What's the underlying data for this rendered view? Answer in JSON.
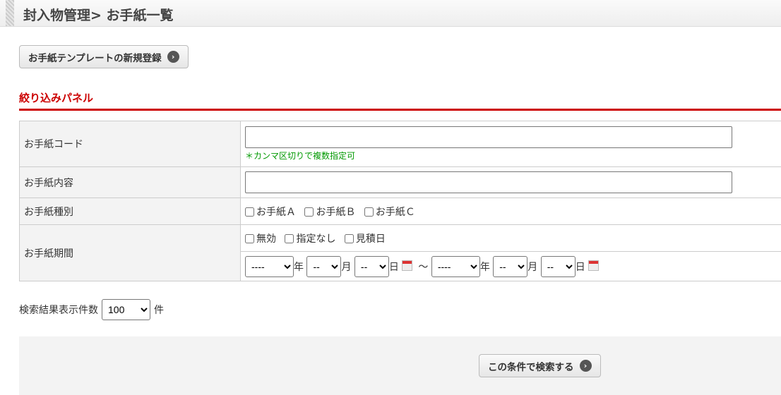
{
  "header": {
    "title": "封入物管理> お手紙一覧"
  },
  "new_button": "お手紙テンプレートの新規登録",
  "panel_title": "絞り込みパネル",
  "fields": {
    "code_label": "お手紙コード",
    "code_value": "",
    "code_note": "＊カンマ区切りで複数指定可",
    "content_label": "お手紙内容",
    "content_value": "",
    "type_label": "お手紙種別",
    "types": [
      "お手紙Ａ",
      "お手紙Ｂ",
      "お手紙Ｃ"
    ],
    "period_label": "お手紙期間",
    "period_options": [
      "無効",
      "指定なし",
      "見積日"
    ],
    "year_value": "----",
    "month_value": "--",
    "day_value": "--",
    "year_unit": "年",
    "month_unit": "月",
    "day_unit": "日",
    "tilde": "～"
  },
  "count": {
    "label": "検索結果表示件数",
    "value": "100",
    "unit": "件"
  },
  "search_button": "この条件で検索する"
}
